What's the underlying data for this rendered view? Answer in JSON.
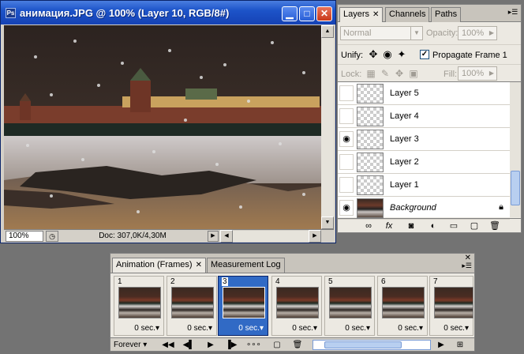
{
  "document": {
    "title": "анимация.JPG @ 100% (Layer 10, RGB/8#)",
    "zoom": "100%",
    "doc_size": "Doc: 307,0K/4,30M",
    "app_badge": "Ps"
  },
  "layers_panel": {
    "tabs": [
      {
        "label": "Layers",
        "active": true
      },
      {
        "label": "Channels",
        "active": false
      },
      {
        "label": "Paths",
        "active": false
      }
    ],
    "blend_mode": "Normal",
    "opacity_label": "Opacity:",
    "opacity_value": "100%",
    "unify_label": "Unify:",
    "propagate_label": "Propagate Frame 1",
    "propagate_checked": true,
    "lock_label": "Lock:",
    "fill_label": "Fill:",
    "fill_value": "100%",
    "layers": [
      {
        "name": "Layer 5",
        "visible": false
      },
      {
        "name": "Layer 4",
        "visible": false
      },
      {
        "name": "Layer 3",
        "visible": true
      },
      {
        "name": "Layer 2",
        "visible": false
      },
      {
        "name": "Layer 1",
        "visible": false
      },
      {
        "name": "Background",
        "visible": true,
        "locked": true
      }
    ]
  },
  "animation_panel": {
    "tabs": [
      {
        "label": "Animation (Frames)",
        "active": true
      },
      {
        "label": "Measurement Log",
        "active": false
      }
    ],
    "frames": [
      {
        "number": "1",
        "delay": "0 sec."
      },
      {
        "number": "2",
        "delay": "0 sec."
      },
      {
        "number": "3",
        "delay": "0 sec.",
        "selected": true
      },
      {
        "number": "4",
        "delay": "0 sec."
      },
      {
        "number": "5",
        "delay": "0 sec."
      },
      {
        "number": "6",
        "delay": "0 sec."
      },
      {
        "number": "7",
        "delay": "0 sec."
      }
    ],
    "loop": "Forever"
  },
  "icons": {
    "eye": "eye-icon",
    "lock": "lock-icon",
    "close": "close-icon",
    "minimize": "minimize-icon",
    "maximize": "maximize-icon"
  },
  "colors": {
    "titlebar": "#1d54c9",
    "selection": "#316ac5",
    "close_button": "#c9391b"
  }
}
